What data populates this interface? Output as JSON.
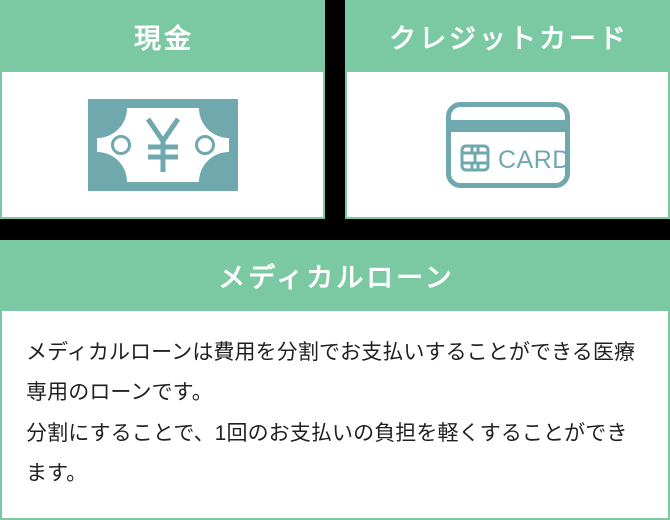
{
  "theme": {
    "header_green": "#7bc9a2",
    "icon_teal": "#6fa8ad",
    "body_white": "#ffffff",
    "page_black": "#000000",
    "text_dark": "#231f20"
  },
  "panels": [
    {
      "id": "cash",
      "title": "現金",
      "icon_name": "banknote-yen-icon",
      "icon_label": "¥"
    },
    {
      "id": "credit",
      "title": "クレジットカード",
      "icon_name": "credit-card-icon",
      "icon_label": "CARD"
    }
  ],
  "loan": {
    "title": "メディカルローン",
    "body_lines": [
      "メディカルローンは費用を分割でお支払いすること",
      "ができる医療専用のローンです。",
      "分割にすることで、1回のお支払いの負担を軽くする",
      "ことができます。"
    ],
    "body_text": "メディカルローンは費用を分割でお支払いすることができる医療専用のローンです。\n分割にすることで、1回のお支払いの負担を軽くすることができます。"
  }
}
